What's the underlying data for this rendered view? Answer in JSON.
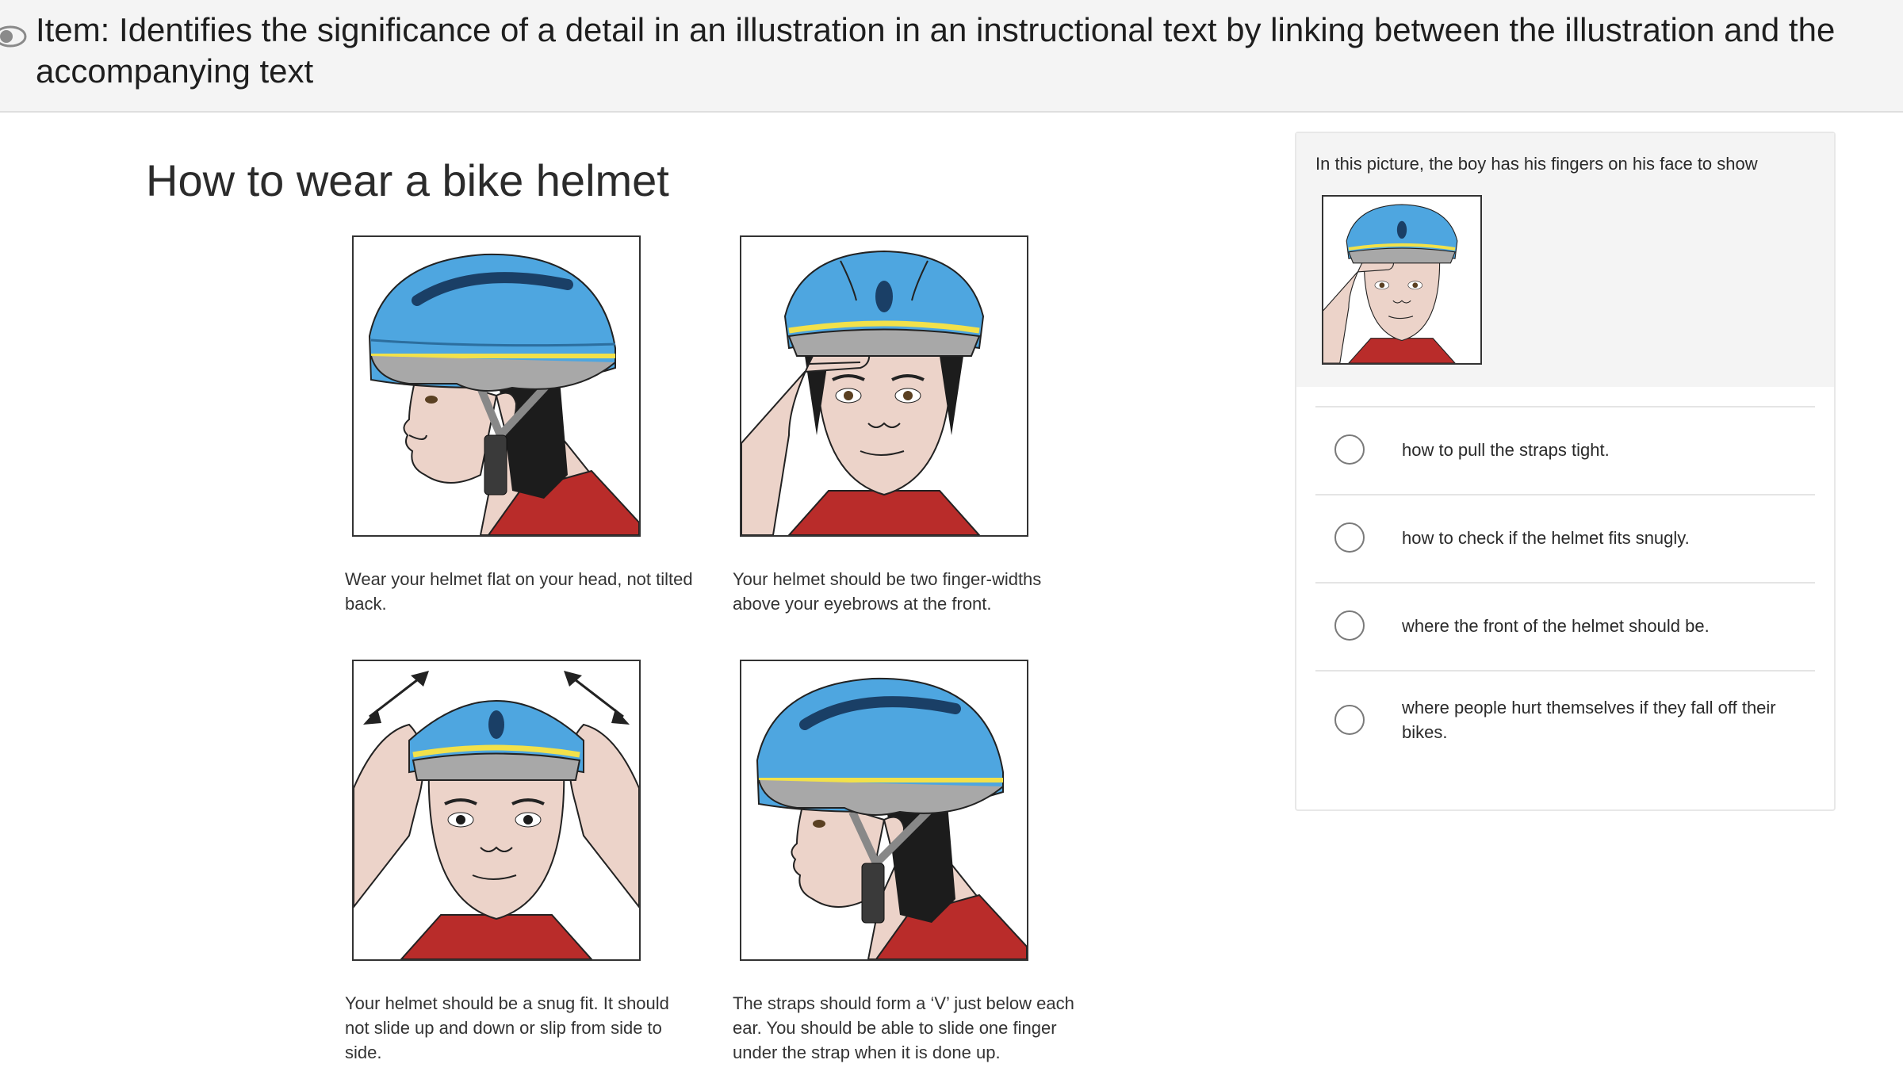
{
  "header": {
    "item_title": "Item: Identifies the significance of a detail in an illustration in an instructional text by linking between the illustration and the accompanying text",
    "preview_icon": "eye-icon"
  },
  "article": {
    "title": "How to wear a bike helmet",
    "cards": [
      {
        "caption": "Wear your helmet flat on your head, not tilted back."
      },
      {
        "caption": "Your helmet should be two finger-widths above your eyebrows at the front."
      },
      {
        "caption": "Your helmet should be a snug fit. It should not slide up and down or slip from side to side."
      },
      {
        "caption": "The straps should form a ‘V’ just below each ear. You should be able to slide one finger under the strap when it is done up."
      }
    ]
  },
  "question": {
    "stem": "In this picture, the boy has his fingers on his face to show",
    "options": [
      {
        "label": "how to pull the straps tight."
      },
      {
        "label": "how to check if the helmet fits snugly."
      },
      {
        "label": "where the front of the helmet should be."
      },
      {
        "label": "where people hurt themselves if they fall off their bikes."
      }
    ]
  },
  "colors": {
    "helmet": "#4ea6e0",
    "helmet_shadow": "#2c6e9e",
    "stripe": "#f2e14a",
    "rim": "#a8a8a8",
    "skin": "#ecd3c9",
    "shirt": "#b92c2a",
    "hair": "#1c1c1c"
  }
}
